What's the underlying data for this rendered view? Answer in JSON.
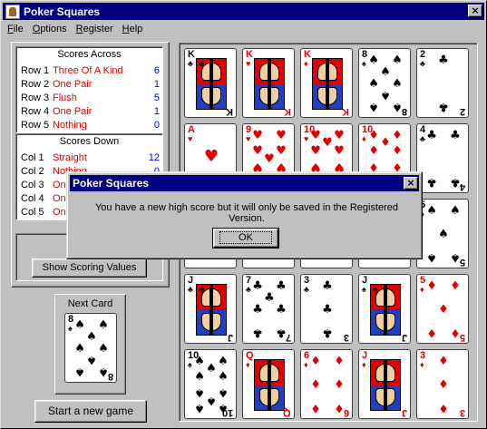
{
  "window": {
    "title": "Poker Squares",
    "close": "×"
  },
  "menu": [
    {
      "pre": "",
      "u": "F",
      "post": "ile"
    },
    {
      "pre": "",
      "u": "O",
      "post": "ptions"
    },
    {
      "pre": "",
      "u": "R",
      "post": "egister"
    },
    {
      "pre": "",
      "u": "H",
      "post": "elp"
    }
  ],
  "scores_across": {
    "heading": "Scores Across",
    "rows": [
      {
        "label": "Row 1",
        "hand": "Three Of A Kind",
        "score": "6"
      },
      {
        "label": "Row 2",
        "hand": "One Pair",
        "score": "1"
      },
      {
        "label": "Row 3",
        "hand": "Flush",
        "score": "5"
      },
      {
        "label": "Row 4",
        "hand": "One Pair",
        "score": "1"
      },
      {
        "label": "Row 5",
        "hand": "Nothing",
        "score": "0"
      }
    ]
  },
  "scores_down": {
    "heading": "Scores Down",
    "rows": [
      {
        "label": "Col 1",
        "hand": "Straight",
        "score": "12"
      },
      {
        "label": "Col 2",
        "hand": "Nothing",
        "score": "0"
      },
      {
        "label": "Col 3",
        "hand": "On",
        "score": ""
      },
      {
        "label": "Col 4",
        "hand": "On",
        "score": ""
      },
      {
        "label": "Col 5",
        "hand": "On",
        "score": ""
      }
    ]
  },
  "buttons": {
    "show_scoring": "Show Scoring Values",
    "new_game": "Start a new game"
  },
  "next_card": {
    "label": "Next Card",
    "rank": "8",
    "suit": "♠",
    "color": "#000000"
  },
  "grid": [
    [
      {
        "rank": "K",
        "suit": "♣",
        "face": true,
        "color": "#000000"
      },
      {
        "rank": "K",
        "suit": "♥",
        "face": true,
        "color": "#e00000"
      },
      {
        "rank": "K",
        "suit": "♦",
        "face": true,
        "color": "#e00000"
      },
      {
        "rank": "8",
        "suit": "♠",
        "color": "#000000"
      },
      {
        "rank": "2",
        "suit": "♣",
        "color": "#000000"
      }
    ],
    [
      {
        "rank": "A",
        "suit": "♥",
        "color": "#e00000"
      },
      {
        "rank": "9",
        "suit": "♥",
        "color": "#e00000"
      },
      {
        "rank": "10",
        "suit": "♥",
        "color": "#e00000"
      },
      {
        "rank": "10",
        "suit": "♦",
        "color": "#e00000"
      },
      {
        "rank": "4",
        "suit": "♣",
        "color": "#000000"
      }
    ],
    [
      {
        "rank": "",
        "suit": "",
        "hidden": true
      },
      {
        "rank": "",
        "suit": "",
        "hidden": true
      },
      {
        "rank": "",
        "suit": "",
        "hidden": true
      },
      {
        "rank": "",
        "suit": "",
        "hidden": true
      },
      {
        "rank": "5",
        "suit": "♠",
        "color": "#000000"
      }
    ],
    [
      {
        "rank": "J",
        "suit": "♣",
        "face": true,
        "color": "#000000"
      },
      {
        "rank": "7",
        "suit": "♣",
        "color": "#000000"
      },
      {
        "rank": "3",
        "suit": "♣",
        "color": "#000000"
      },
      {
        "rank": "J",
        "suit": "♠",
        "face": true,
        "color": "#000000"
      },
      {
        "rank": "5",
        "suit": "♦",
        "color": "#e00000"
      }
    ],
    [
      {
        "rank": "10",
        "suit": "♠",
        "color": "#000000"
      },
      {
        "rank": "Q",
        "suit": "♦",
        "face": true,
        "color": "#e00000"
      },
      {
        "rank": "6",
        "suit": "♦",
        "color": "#e00000"
      },
      {
        "rank": "J",
        "suit": "♦",
        "face": true,
        "color": "#e00000"
      },
      {
        "rank": "3",
        "suit": "♦",
        "color": "#e00000"
      }
    ]
  ],
  "dialog": {
    "title": "Poker Squares",
    "close": "×",
    "message": "You have a new high score but it will only be saved in the Registered Version.",
    "ok": "OK"
  }
}
